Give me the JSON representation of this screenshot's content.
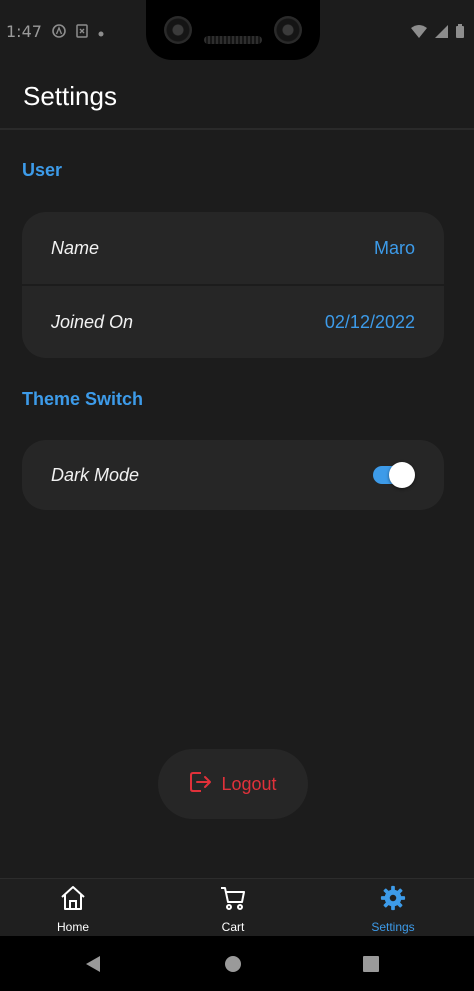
{
  "status_bar": {
    "time": "1:47"
  },
  "app_bar": {
    "title": "Settings"
  },
  "sections": {
    "user": {
      "title": "User",
      "rows": [
        {
          "label": "Name",
          "value": "Maro"
        },
        {
          "label": "Joined On",
          "value": "02/12/2022"
        }
      ]
    },
    "theme": {
      "title": "Theme Switch",
      "dark_mode_label": "Dark Mode",
      "dark_mode_on": true
    }
  },
  "logout": {
    "label": "Logout"
  },
  "bottom_nav": {
    "items": [
      {
        "label": "Home",
        "icon": "home-icon",
        "active": false
      },
      {
        "label": "Cart",
        "icon": "cart-icon",
        "active": false
      },
      {
        "label": "Settings",
        "icon": "gear-icon",
        "active": true
      }
    ]
  },
  "colors": {
    "accent": "#3d9be9",
    "background": "#1c1c1c",
    "card": "#262626",
    "logout": "#e0313a"
  }
}
